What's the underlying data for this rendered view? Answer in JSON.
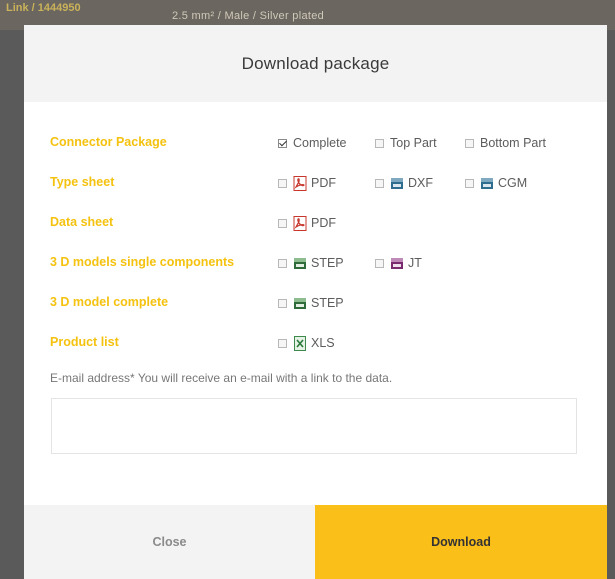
{
  "background": {
    "left_text": "Link / 1444950",
    "middle_text": "2.5 mm²   /   Male   /   Silver plated"
  },
  "modal": {
    "title": "Download package",
    "rows": [
      {
        "label": "Connector Package",
        "options": [
          {
            "label": "Complete",
            "checked": true,
            "icon": null
          },
          {
            "label": "Top Part",
            "checked": false,
            "icon": null
          },
          {
            "label": "Bottom Part",
            "checked": false,
            "icon": null
          }
        ]
      },
      {
        "label": "Type sheet",
        "options": [
          {
            "label": "PDF",
            "checked": false,
            "icon": "pdf-icon"
          },
          {
            "label": "DXF",
            "checked": false,
            "icon": "dxf-icon"
          },
          {
            "label": "CGM",
            "checked": false,
            "icon": "cgm-icon"
          }
        ]
      },
      {
        "label": "Data sheet",
        "options": [
          {
            "label": "PDF",
            "checked": false,
            "icon": "pdf-icon"
          }
        ]
      },
      {
        "label": "3 D models single components",
        "options": [
          {
            "label": "STEP",
            "checked": false,
            "icon": "step-icon"
          },
          {
            "label": "JT",
            "checked": false,
            "icon": "jt-icon"
          }
        ]
      },
      {
        "label": "3 D model complete",
        "options": [
          {
            "label": "STEP",
            "checked": false,
            "icon": "step-icon"
          }
        ]
      },
      {
        "label": "Product list",
        "options": [
          {
            "label": "XLS",
            "checked": false,
            "icon": "xls-icon"
          }
        ]
      }
    ],
    "email": {
      "label": "E-mail address* You will receive an e-mail with a link to the data.",
      "value": "",
      "placeholder": ""
    },
    "buttons": {
      "close": "Close",
      "download": "Download"
    }
  },
  "colors": {
    "accent": "#fbbf1a",
    "label": "#f4c20f",
    "header_bg": "#f3f3f3",
    "overlay": "#5a5a5a"
  }
}
